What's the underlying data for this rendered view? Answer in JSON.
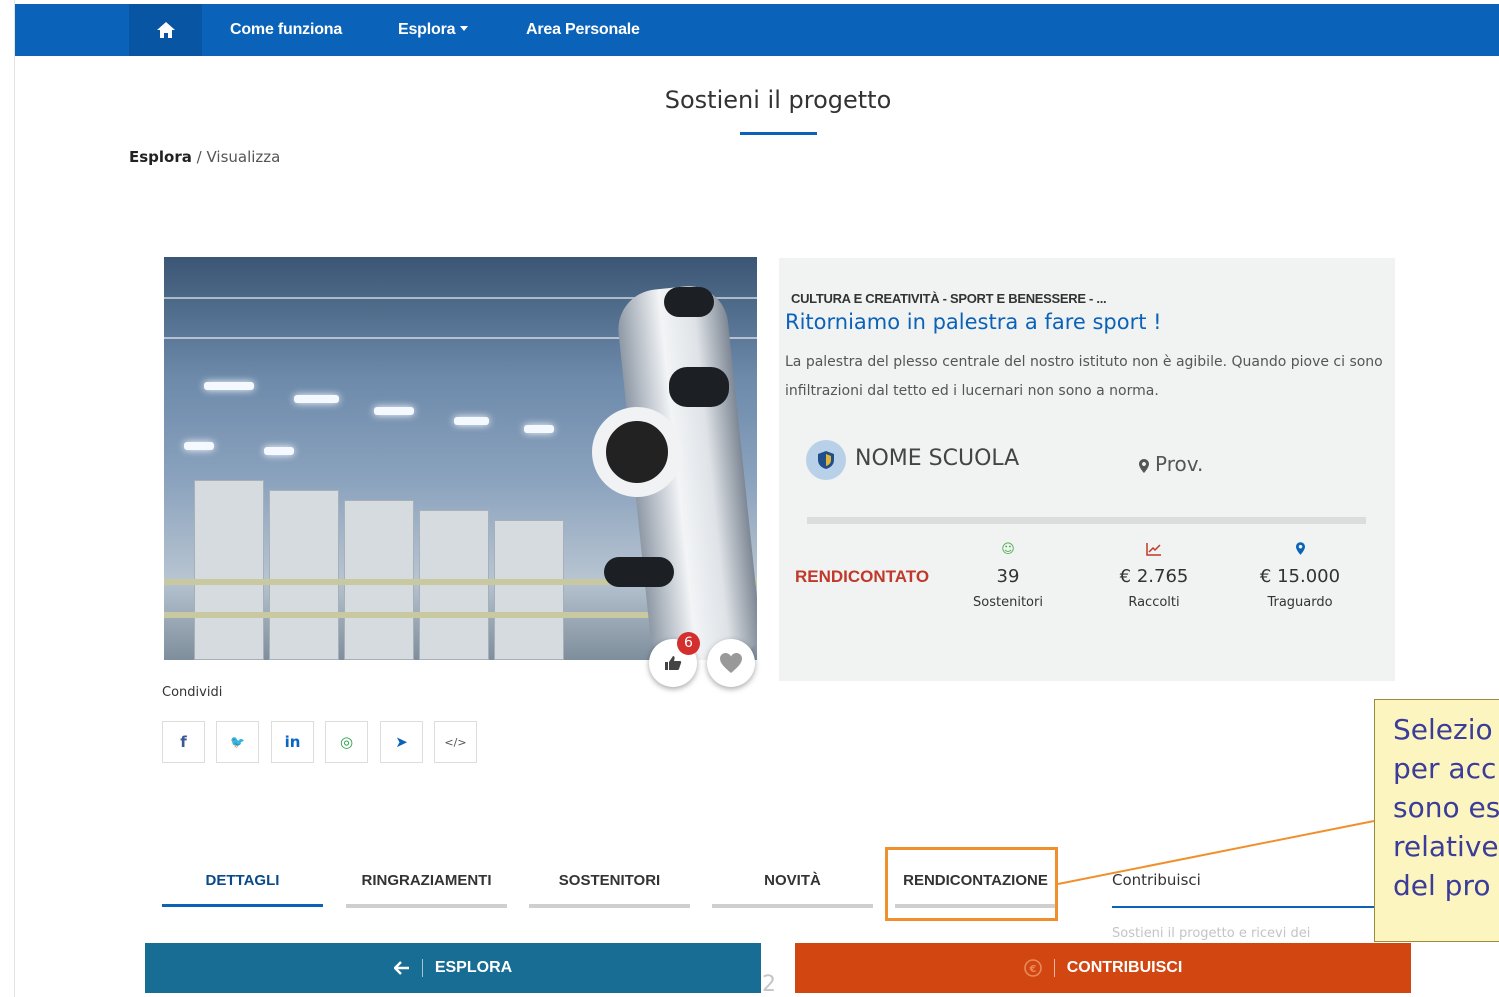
{
  "nav": {
    "items": [
      "Come funziona",
      "Esplora",
      "Area Personale"
    ]
  },
  "page": {
    "title": "Sostieni il progetto"
  },
  "breadcrumb": {
    "root": "Esplora",
    "separator": " / ",
    "current": "Visualizza"
  },
  "project": {
    "categories": "CULTURA E CREATIVITÀ - SPORT E BENESSERE - ...",
    "title": "Ritorniamo in palestra a fare sport !",
    "description": "La palestra del plesso centrale del nostro istituto non è agibile. Quando piove ci sono infiltrazioni dal tetto ed i lucernari non sono a norma.",
    "school": "NOME SCUOLA",
    "province": "Prov.",
    "status": "RENDICONTATO",
    "likes": "6",
    "stats": [
      {
        "value": "39",
        "label": "Sostenitori",
        "icon": "smile-icon"
      },
      {
        "value": "€ 2.765",
        "label": "Raccolti",
        "icon": "chart-line-icon"
      },
      {
        "value": "€ 15.000",
        "label": "Traguardo",
        "icon": "map-marker-icon"
      }
    ]
  },
  "share": {
    "label": "Condividi",
    "icons": [
      "facebook-icon",
      "twitter-icon",
      "linkedin-icon",
      "whatsapp-icon",
      "telegram-icon",
      "embed-code-icon"
    ],
    "glyphs": [
      "f",
      "🐦",
      "in",
      "◎",
      "➤",
      "</>"
    ]
  },
  "tabs": [
    "DETTAGLI",
    "RINGRAZIAMENTI",
    "SOSTENITORI",
    "NOVITÀ",
    "RENDICONTAZIONE"
  ],
  "sidebar": {
    "title": "Contribuisci",
    "text": "Sostieni il progetto e ricevi dei"
  },
  "tooltip": {
    "lines": [
      "Selezio",
      "per acc",
      "sono es",
      "relative",
      "del pro"
    ]
  },
  "buttons": {
    "back": "ESPLORA",
    "contribute": "CONTRIBUISCI"
  },
  "page_number": "2",
  "colors": {
    "nav": "#0a62b9",
    "status": "#c0392b",
    "back_button": "#176d93",
    "contribute_button": "#d24612",
    "highlight": "#f0902c"
  }
}
